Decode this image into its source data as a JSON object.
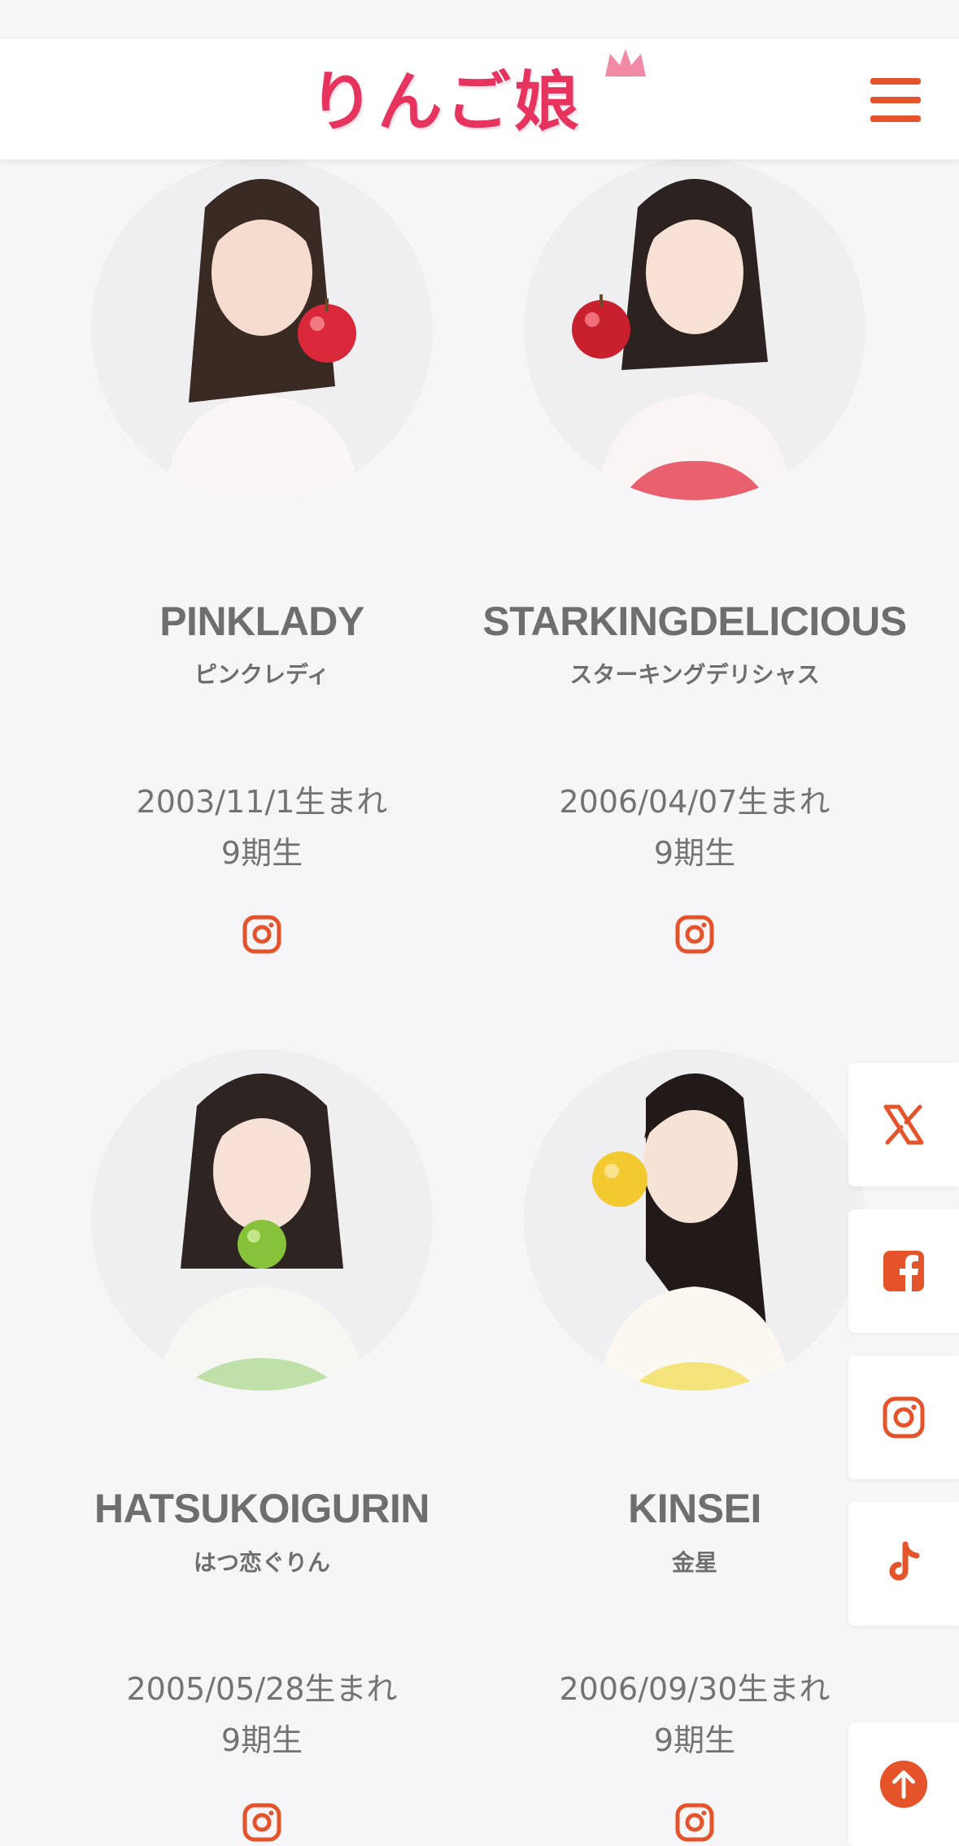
{
  "header": {
    "logo_text": "りんご娘",
    "menu_icon": "hamburger-menu-icon"
  },
  "members": [
    {
      "name": "PINKLADY",
      "kana": "ピンクレディ",
      "birth": "2003/11/1生まれ",
      "generation": "9期生",
      "apple_color": "#d8283a"
    },
    {
      "name": "STARKINGDELICIOUS",
      "kana": "スターキングデリシャス",
      "birth": "2006/04/07生まれ",
      "generation": "9期生",
      "apple_color": "#c9202e"
    },
    {
      "name": "HATSUKOIGURIN",
      "kana": "はつ恋ぐりん",
      "birth": "2005/05/28生まれ",
      "generation": "9期生",
      "apple_color": "#86c23a"
    },
    {
      "name": "KINSEI",
      "kana": "金星",
      "birth": "2006/09/30生まれ",
      "generation": "9期生",
      "apple_color": "#f2c92e"
    }
  ],
  "social_sidebar": [
    "x-icon",
    "facebook-icon",
    "instagram-icon",
    "tiktok-icon"
  ],
  "back_to_top_icon": "arrow-up-icon",
  "colors": {
    "accent": "#e5532a",
    "brand_pink": "#e6345f",
    "background": "#f6f6f8"
  }
}
